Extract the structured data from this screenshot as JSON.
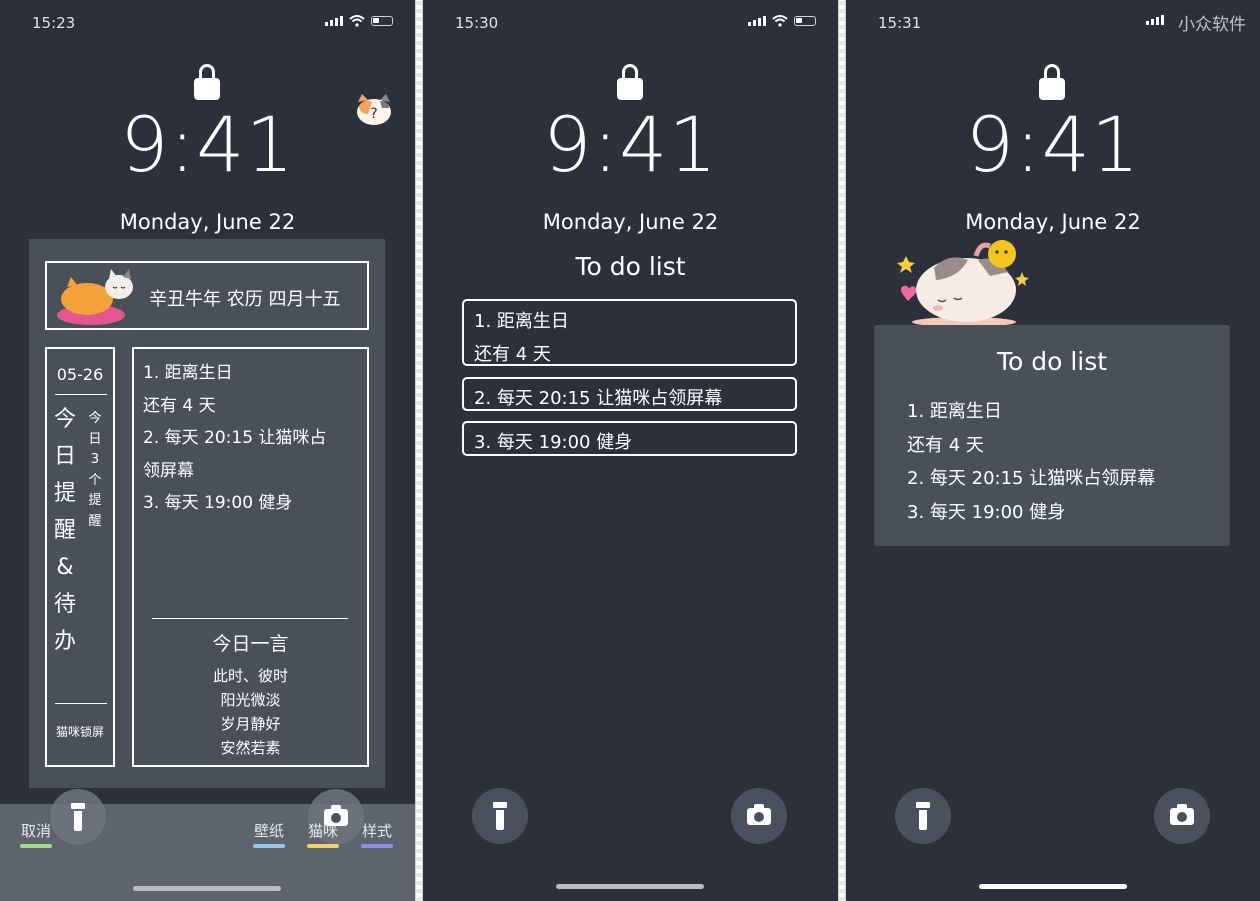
{
  "watermark": "小众软件",
  "phone1": {
    "status_time": "15:23",
    "clock": "9:41",
    "date": "Monday, June 22",
    "header_text": "辛丑牛年 农历 四月十五",
    "date_short": "05-26",
    "vertical_title": [
      "今",
      "日",
      "提",
      "醒",
      "&",
      "待",
      "办"
    ],
    "vertical_sub": [
      "今",
      "日",
      "3",
      "个",
      "提",
      "醒"
    ],
    "brand": "猫咪锁屏",
    "todo_lines": [
      "1. 距离生日",
      "还有 4 天",
      "2. 每天 20:15  让猫咪占",
      "领屏幕",
      "3. 每天 19:00  健身"
    ],
    "quote_title": "今日一言",
    "quote_lines": [
      "此时、彼时",
      "阳光微淡",
      "岁月静好",
      "安然若素"
    ],
    "toolbar": {
      "cancel": "取消",
      "wallpaper": "壁纸",
      "cat": "猫咪",
      "style": "样式",
      "colors": {
        "cancel": "#9be07a",
        "wallpaper": "#8ec9f0",
        "cat": "#f3d35a",
        "style": "#8f8df0"
      }
    }
  },
  "phone2": {
    "status_time": "15:30",
    "clock": "9:41",
    "date": "Monday, June 22",
    "title": "To do list",
    "items": [
      {
        "line1": "1. 距离生日",
        "line2": "还有 4 天"
      },
      {
        "line1": "2. 每天 20:15 让猫咪占领屏幕"
      },
      {
        "line1": "3. 每天 19:00 健身"
      }
    ]
  },
  "phone3": {
    "status_time": "15:31",
    "clock": "9:41",
    "date": "Monday, June 22",
    "title": "To do list",
    "lines": [
      "1. 距离生日",
      "还有 4 天",
      "2. 每天 20:15 让猫咪占领屏幕",
      "3. 每天 19:00 健身"
    ]
  },
  "colors": {
    "background": "#2b303a",
    "panel": "#4a505a",
    "button": "#4b515c"
  }
}
